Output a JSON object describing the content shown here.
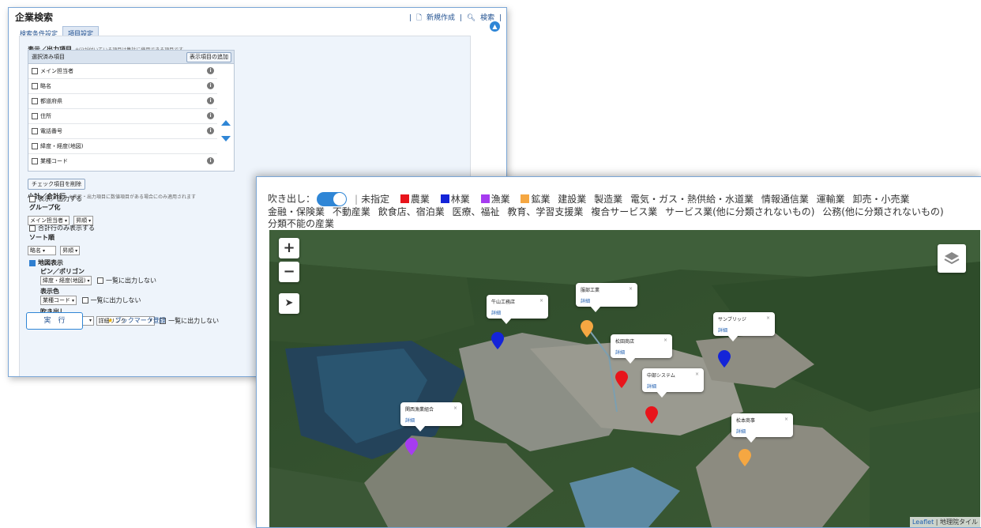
{
  "search": {
    "title": "企業検索",
    "new_link": "新規作成",
    "search_link": "検索",
    "tabs": [
      "検索条件設定",
      "項目設定"
    ],
    "display_section": {
      "title": "表示／出力項目",
      "note": "※(i)が付いている項目は集計に使用できる項目です"
    },
    "selected_header": "選択済み項目",
    "add_button": "表示項目の追加",
    "items": [
      "メイン担当者",
      "略名",
      "都道府県",
      "住所",
      "電話番号",
      "緯度・経度(地図)",
      "業種コード"
    ],
    "items_info": [
      true,
      true,
      true,
      true,
      true,
      false,
      true
    ],
    "delete_checked": "チェック項目を削除",
    "subtotal": {
      "title": "小計／合計行",
      "note": "※表示・出力項目に数値項目がある場合にのみ適用されます",
      "show_label": "表示／出力する"
    },
    "group_label": "グループ化",
    "group_field": "メイン担当者",
    "group_order": "昇順",
    "totals_only_label": "合計行のみ表示する",
    "sort_label": "ソート順",
    "sort_field": "略名",
    "sort_order": "昇順",
    "map_display_label": "地図表示",
    "pin_label": "ピン／ポリゴン",
    "pin_field": "緯度・経度(地図)",
    "no_list_output": "一覧に出力しない",
    "color_label": "表示色",
    "color_field": "業種コード",
    "balloon_label": "吹き出し",
    "balloon_field": "略名",
    "balloon_link": "詳細リンク",
    "run_button": "実　行",
    "bookmark_label": "ブックマーク登録"
  },
  "map": {
    "balloon_toggle_label": "吹き出し：",
    "balloon_toggle_on": true,
    "legend": [
      {
        "label": "未指定",
        "color": ""
      },
      {
        "label": "農業",
        "color": "#e8141b"
      },
      {
        "label": "林業",
        "color": "#1424d8"
      },
      {
        "label": "漁業",
        "color": "#a63cf0"
      },
      {
        "label": "鉱業",
        "color": "#f5a742"
      },
      {
        "label": "建設業",
        "color": ""
      },
      {
        "label": "製造業",
        "color": ""
      },
      {
        "label": "電気・ガス・熱供給・水道業",
        "color": ""
      },
      {
        "label": "情報通信業",
        "color": ""
      },
      {
        "label": "運輸業",
        "color": ""
      },
      {
        "label": "卸売・小売業",
        "color": ""
      },
      {
        "label": "金融・保険業",
        "color": ""
      },
      {
        "label": "不動産業",
        "color": ""
      },
      {
        "label": "飲食店、宿泊業",
        "color": ""
      },
      {
        "label": "医療、福祉",
        "color": ""
      },
      {
        "label": "教育、学習支援業",
        "color": ""
      },
      {
        "label": "複合サービス業",
        "color": ""
      },
      {
        "label": "サービス業(他に分類されないもの)",
        "color": ""
      },
      {
        "label": "公務(他に分類されないもの)",
        "color": ""
      },
      {
        "label": "分類不能の産業",
        "color": ""
      }
    ],
    "zoom_in": "+",
    "zoom_out": "−",
    "markers": [
      {
        "name": "牛山工務店",
        "detail": "詳細",
        "color": "#1424d8"
      },
      {
        "name": "服部工業",
        "detail": "詳細",
        "color": "#f5a742"
      },
      {
        "name": "松田商店",
        "detail": "詳細",
        "color": "#e8141b"
      },
      {
        "name": "サンブリッジ",
        "detail": "詳細",
        "color": "#1424d8"
      },
      {
        "name": "中部システム",
        "detail": "詳細",
        "color": "#e8141b"
      },
      {
        "name": "関西漁業組合",
        "detail": "詳細",
        "color": "#a63cf0"
      },
      {
        "name": "松本商事",
        "detail": "詳細",
        "color": "#f5a742"
      }
    ],
    "attribution_leaflet": "Leaflet",
    "attribution_tiles": "地理院タイル"
  }
}
